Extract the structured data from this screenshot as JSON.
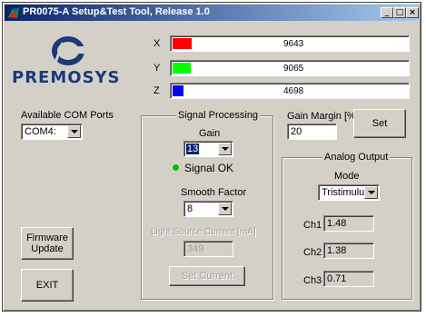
{
  "window": {
    "title": "PR0075-A Setup&Test Tool, Release 1.0",
    "controls": {
      "minimize": "_",
      "maximize": "□",
      "close": "×"
    }
  },
  "logo": {
    "text": "PREMOSYS"
  },
  "bars": [
    {
      "label": "X",
      "value": "9643",
      "fill_fraction": 0.08,
      "color": "#ff0000"
    },
    {
      "label": "Y",
      "value": "9065",
      "fill_fraction": 0.075,
      "color": "#00ff00"
    },
    {
      "label": "Z",
      "value": "4698",
      "fill_fraction": 0.045,
      "color": "#0000ff"
    }
  ],
  "com": {
    "label": "Available COM Ports",
    "selected": "COM4:"
  },
  "signal": {
    "group_title": "Signal Processing",
    "gain_label": "Gain",
    "gain_value": "13",
    "status_text": "Signal OK",
    "status_color": "#00c000",
    "smooth_label": "Smooth Factor",
    "smooth_value": "8",
    "light_label": "Light Source Current [mA]",
    "light_value": "349",
    "set_current_label": "Set Current"
  },
  "gain_margin": {
    "label": "Gain Margin [%]",
    "value": "20",
    "set_label": "Set"
  },
  "analog": {
    "group_title": "Analog Output",
    "mode_label": "Mode",
    "mode_value": "Tristimulus",
    "channels": [
      {
        "label": "Ch1",
        "value": "1.48"
      },
      {
        "label": "Ch2",
        "value": "1.38"
      },
      {
        "label": "Ch3",
        "value": "0.71"
      }
    ]
  },
  "buttons": {
    "firmware_update": "Firmware Update",
    "exit": "EXIT"
  }
}
